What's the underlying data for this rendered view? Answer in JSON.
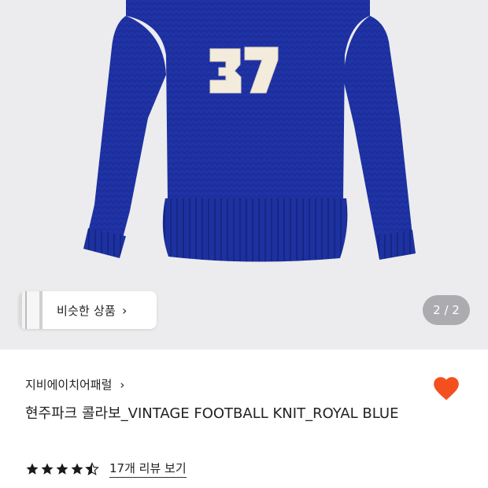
{
  "product_image": {
    "alt": "sweater-photo",
    "jersey_number": "37",
    "colors": {
      "sweater": "#1f33a6",
      "patch": "#f3ecdc",
      "background": "#ececee"
    }
  },
  "similar_button": {
    "label": "비슷한 상품"
  },
  "pager": {
    "text": "2 / 2"
  },
  "brand": {
    "name": "지비에이치어패럴"
  },
  "title": "현주파크 콜라보_VINTAGE FOOTBALL KNIT_ROYAL BLUE",
  "rating": {
    "value": 4.5,
    "max": 5,
    "reviews_label": "17개 리뷰 보기"
  },
  "wishlist": {
    "icon": "heart-icon",
    "color": "#f4501f"
  }
}
